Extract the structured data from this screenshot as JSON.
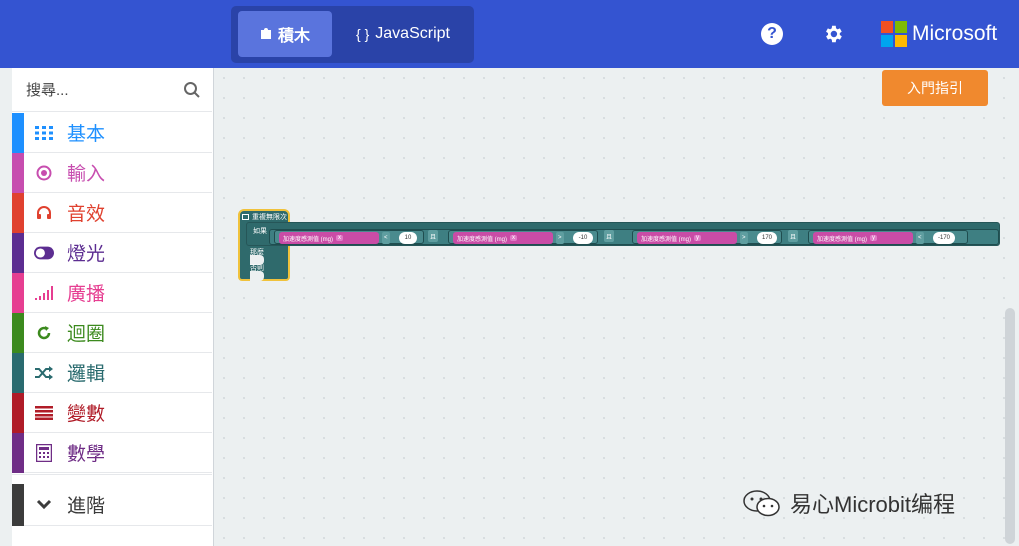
{
  "header": {
    "tabs": [
      {
        "label": "積木",
        "icon": "puzzle-icon"
      },
      {
        "label": "JavaScript",
        "icon": "braces-icon"
      }
    ],
    "brand": "Microsoft",
    "colors": {
      "bar": "#3454d1",
      "ms_red": "#f25022",
      "ms_green": "#7fba00",
      "ms_blue": "#00a4ef",
      "ms_yellow": "#ffb900"
    }
  },
  "sidebar": {
    "search_placeholder": "搜尋...",
    "categories": [
      {
        "label": "基本",
        "icon": "grid-icon",
        "color": "#1e90ff"
      },
      {
        "label": "輸入",
        "icon": "radio-icon",
        "color": "#c74daf"
      },
      {
        "label": "音效",
        "icon": "headphones-icon",
        "color": "#e0412f"
      },
      {
        "label": "燈光",
        "icon": "toggle-icon",
        "color": "#5c2d91"
      },
      {
        "label": "廣播",
        "icon": "signal-icon",
        "color": "#e63e91"
      },
      {
        "label": "迴圈",
        "icon": "refresh-icon",
        "color": "#3c8a1e"
      },
      {
        "label": "邏輯",
        "icon": "shuffle-icon",
        "color": "#2a6b6f"
      },
      {
        "label": "變數",
        "icon": "list-icon",
        "color": "#b01c28"
      },
      {
        "label": "數學",
        "icon": "calculator-icon",
        "color": "#6f2d86"
      },
      {
        "label": "進階",
        "icon": "chevron-down-icon",
        "color": "#3c3c3c"
      }
    ]
  },
  "workspace": {
    "tutorial_button": "入門指引",
    "blocks": {
      "hat": "重複無限次",
      "if": "如果",
      "then": "那麼",
      "else": "否則",
      "conditions": [
        {
          "label": "加速度感測值 (mg)",
          "axis": "x",
          "op": "<",
          "value": "10"
        },
        {
          "label": "加速度感測值 (mg)",
          "axis": "x",
          "op": ">",
          "value": "-10"
        },
        {
          "label": "加速度感測值 (mg)",
          "axis": "y",
          "op": ">",
          "value": "170"
        },
        {
          "label": "加速度感測值 (mg)",
          "axis": "y",
          "op": "<",
          "value": "-170"
        }
      ],
      "and1": "且",
      "and2": "且",
      "and3": "且"
    }
  },
  "watermark": "易心Microbit编程"
}
